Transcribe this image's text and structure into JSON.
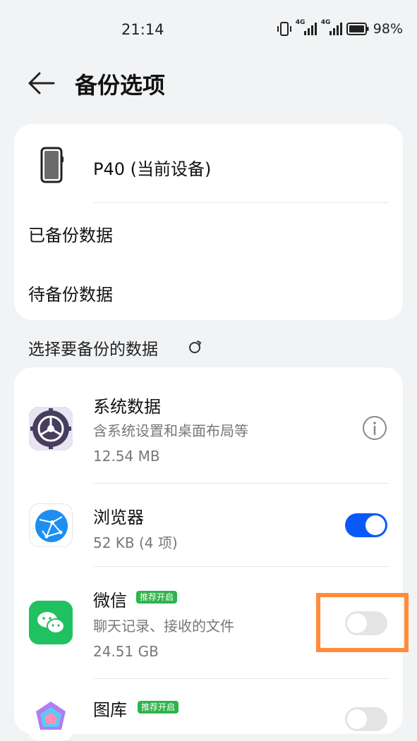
{
  "status_bar": {
    "time": "21:14",
    "battery_text": "98%",
    "signal1_label": "4G",
    "signal2_label": "4G"
  },
  "header": {
    "title": "备份选项",
    "back_icon": "arrow-left-icon"
  },
  "device": {
    "name": "P40 (当前设备)",
    "icon": "phone-icon"
  },
  "menu": {
    "backed_up": "已备份数据",
    "pending": "待备份数据"
  },
  "section": {
    "title": "选择要备份的数据",
    "refresh_icon": "refresh-icon"
  },
  "apps": [
    {
      "name": "系统数据",
      "subtitle": "含系统设置和桌面布局等",
      "size": "12.54 MB",
      "icon": "system-settings-icon",
      "control": "info"
    },
    {
      "name": "浏览器",
      "subtitle": "",
      "size": "52 KB (4 项)",
      "icon": "browser-icon",
      "control": "toggle",
      "enabled": true
    },
    {
      "name": "微信",
      "badge": "推荐开启",
      "subtitle": "聊天记录、接收的文件",
      "size": "24.51 GB",
      "icon": "wechat-icon",
      "control": "toggle",
      "enabled": false
    },
    {
      "name": "图库",
      "badge": "推荐开启",
      "icon": "gallery-icon",
      "control": "toggle",
      "enabled": false
    }
  ],
  "colors": {
    "accent": "#0a59f7",
    "badge_green": "#2fb34a",
    "highlight": "#ff8c38"
  }
}
